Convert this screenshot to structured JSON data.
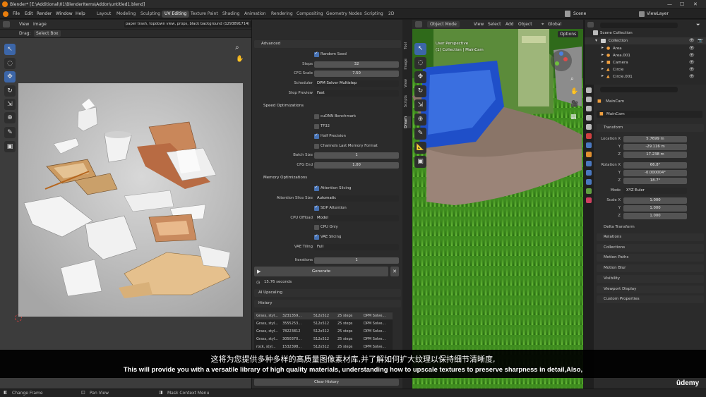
{
  "window_title": "Blender* [E:\\Additional\\01\\BlenderItems\\Addon\\untitled1.blend]",
  "menus": [
    "File",
    "Edit",
    "Render",
    "Window",
    "Help"
  ],
  "workspaces": [
    "Layout",
    "Modeling",
    "Sculpting",
    "UV Editing",
    "Texture Paint",
    "Shading",
    "Animation",
    "Rendering",
    "Compositing",
    "Geometry Nodes",
    "Scripting",
    "2D"
  ],
  "active_workspace": "UV Editing",
  "scene": "Scene",
  "view_layer": "ViewLayer",
  "uv_editor": {
    "menu": [
      "View",
      "Image"
    ],
    "image_name": "paper trash, topdown view, props, black background (1293891714)",
    "drag_label": "Drag:",
    "drag_mode": "Select Box"
  },
  "panel": {
    "advanced_title": "Advanced",
    "random_seed": "Random Seed",
    "steps_label": "Steps",
    "steps": "32",
    "cfg_label": "CFG Scale",
    "cfg": "7.50",
    "scheduler_label": "Scheduler",
    "scheduler": "DPM Solver Multistep",
    "preview_label": "Step Preview",
    "preview": "Fast",
    "speed_title": "Speed Optimizations",
    "cudnn": "cuDNN Benchmark",
    "tf32": "TF32",
    "half": "Half Precision",
    "channels_last": "Channels Last Memory Format",
    "batch_label": "Batch Size",
    "batch": "1",
    "cfgend_label": "CFG End",
    "cfgend": "1.00",
    "memory_title": "Memory Optimizations",
    "attn_slicing": "Attention Slicing",
    "attn_size_label": "Attention Slice Size",
    "attn_size": "Automatic",
    "sdp": "SDP Attention",
    "offload_label": "CPU Offload",
    "offload": "Model",
    "cpu_only": "CPU Only",
    "vae_slicing": "VAE Slicing",
    "vae_tiling_label": "VAE Tiling",
    "vae_tiling": "Full",
    "iterations_label": "Iterations",
    "iterations": "1",
    "generate": "Generate",
    "time": "15.76 seconds",
    "upscaling": "AI Upscaling",
    "history": "History",
    "history_rows": [
      [
        "Grass, styl...",
        "3231359...",
        "512x512",
        "25 steps",
        "DPM Solve..."
      ],
      [
        "Grass, styl...",
        "3555253...",
        "512x512",
        "25 steps",
        "DPM Solve..."
      ],
      [
        "Grass, styl...",
        "78223812",
        "512x512",
        "25 steps",
        "DPM Solve..."
      ],
      [
        "Grass, styl...",
        "3050370...",
        "512x512",
        "25 steps",
        "DPM Solve..."
      ],
      [
        "rock, styl...",
        "1532398...",
        "512x512",
        "25 steps",
        "DPM Solve..."
      ]
    ],
    "clear_history": "Clear History"
  },
  "ntabs": [
    "Tool",
    "Image",
    "View",
    "Scripts",
    "Dream"
  ],
  "viewport": {
    "mode": "Object Mode",
    "menu": [
      "View",
      "Select",
      "Add",
      "Object"
    ],
    "orientation": "Global",
    "options": "Options",
    "view_name": "User Perspective",
    "view_info": "(1) Collection | MainCam"
  },
  "outliner": {
    "scene_collection": "Scene Collection",
    "collection": "Collection",
    "items": [
      "Area",
      "Area.001",
      "Camera",
      "Circle",
      "Circle.001"
    ]
  },
  "properties": {
    "object_name": "MainCam",
    "object_data": "MainCam",
    "transform": "Transform",
    "location_label": "Location X",
    "loc_x": "5.7699 m",
    "loc_y": "-29.116 m",
    "loc_z": "17.238 m",
    "rotation_label": "Rotation X",
    "rot_x": "66.8°",
    "rot_y": "-0.000004°",
    "rot_z": "18.7°",
    "mode_label": "Mode",
    "mode": "XYZ Euler",
    "scale_label": "Scale X",
    "sc_x": "1.000",
    "sc_y": "1.000",
    "sc_z": "1.000",
    "y": "Y",
    "z": "Z",
    "sections": [
      "Delta Transform",
      "Relations",
      "Collections",
      "Motion Paths",
      "Motion Blur",
      "Visibility",
      "Viewport Display",
      "Custom Properties"
    ]
  },
  "status": [
    "Change Frame",
    "Pan View",
    "Mask Context Menu"
  ],
  "subtitles": {
    "zh": "这将为您提供多种多样的高质量图像素材库,并了解如何扩大纹理以保持细节清晰度,",
    "en": "This will provide you with a versatile library of high quality materials, understanding how to upscale textures to preserve sharpness in detail,Also,"
  },
  "watermark": "ûdemy",
  "colors": {
    "accent": "#4772b3",
    "active_tool": "#3c66a8",
    "grass": "#3e8a1e"
  }
}
